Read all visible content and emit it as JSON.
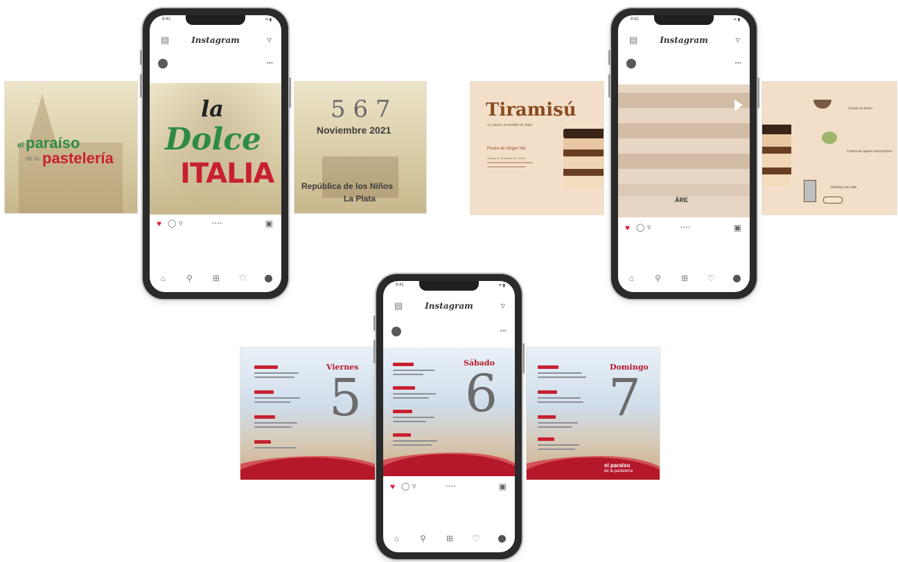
{
  "instagram": {
    "app_title": "Instagram",
    "top_left_icon": "camera-icon",
    "top_right_icon": "send-icon",
    "more_label": "•••",
    "action_icons": [
      "heart-icon",
      "comment-icon",
      "share-icon",
      "bookmark-icon"
    ],
    "dots_label": "••••",
    "nav_icons": [
      "home-icon",
      "search-icon",
      "add-icon",
      "heart-icon",
      "profile-icon"
    ],
    "status_time": "9:41",
    "status_right": "•• ▮"
  },
  "mock1": {
    "left_slide": {
      "line1": "el",
      "line2": "paraíso",
      "line3": "de la",
      "line4": "pastelería"
    },
    "center_post": {
      "la": "la",
      "dolce": "Dolce",
      "italia": "ITALIA"
    },
    "right_slide": {
      "numbers": "5 6 7",
      "month": "Noviembre 2021",
      "place1": "República de los Niños",
      "place2": "La Plata"
    }
  },
  "mock2": {
    "left_slide": {
      "title": "Tiramisú",
      "subtitle": "un clásico irresistible de Italia",
      "heading": "Postre de Origen Ital",
      "body": "Creado en la ciudad de Treviso"
    },
    "center_post": {
      "logo": "ÁRE"
    },
    "right_slide": {
      "label1": "Cacao en polvo",
      "label2": "Crema de queso mascarpone",
      "label3": "Vainillas con café"
    }
  },
  "mock3": {
    "left_slide": {
      "day": "Viernes",
      "number": "5"
    },
    "center_post": {
      "day": "Sábado",
      "number": "6"
    },
    "right_slide": {
      "day": "Domingo",
      "number": "7",
      "logo1": "el paraíso",
      "logo2": "de la pastelería"
    }
  },
  "colors": {
    "ig_heart": "#d81e3c",
    "italia_red": "#c8202e",
    "dolce_green": "#2e8b45",
    "tiramisu_brown": "#8a4b1e",
    "peach": "#f3dfc9",
    "wave_red": "#b5182a"
  }
}
